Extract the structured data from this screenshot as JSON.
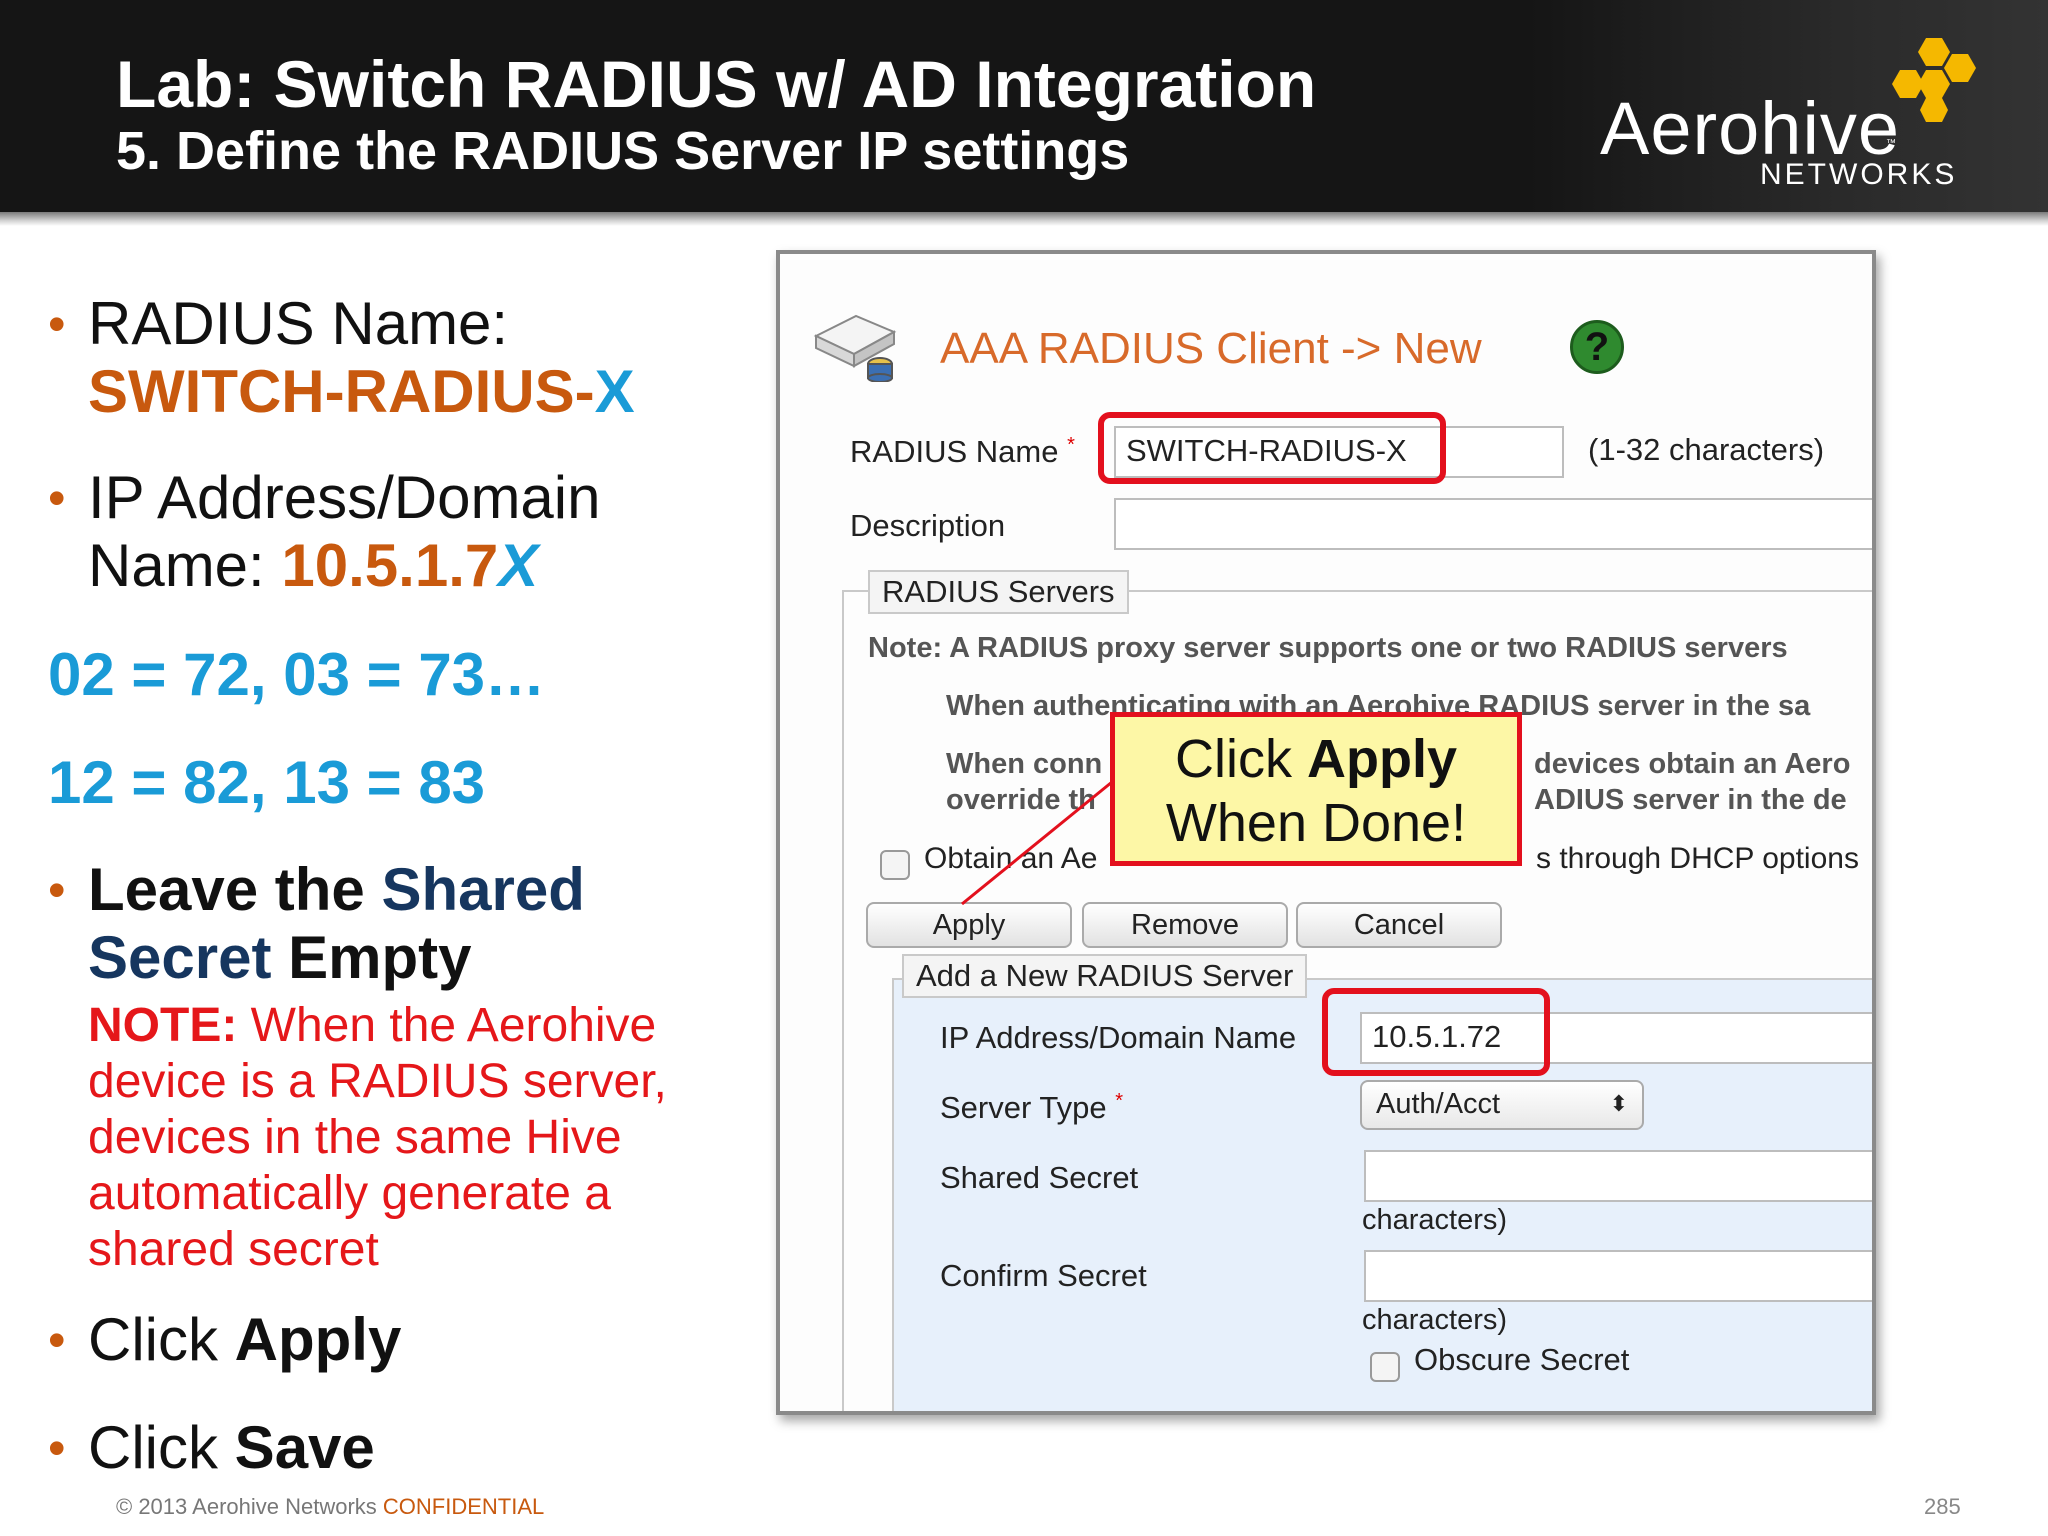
{
  "header": {
    "title": "Lab: Switch RADIUS w/ AD Integration",
    "subtitle": "5. Define the RADIUS Server IP settings",
    "logo_word": "Aerohive",
    "logo_tm": "™",
    "logo_networks": "NETWORKS"
  },
  "bullets": {
    "b1_label": "RADIUS Name:",
    "b1_value_main": "SWITCH-RADIUS-",
    "b1_value_var": "X",
    "b2_line1": "IP Address/Domain",
    "b2_line2_label": "Name: ",
    "b2_value_main": "10.5.1.7",
    "b2_value_var": "X",
    "map1": "02 = 72, 03 = 73…",
    "map2": "12 = 82, 13 = 83",
    "b3_leave": "Leave the ",
    "b3_shared": "Shared",
    "b3_secret": "Secret",
    "b3_empty": " Empty",
    "note_label": "NOTE:",
    "note_l1": " When the Aerohive",
    "note_l2": "device is a RADIUS server,",
    "note_l3": "devices in the same Hive",
    "note_l4": "automatically generate a",
    "note_l5": "shared secret",
    "b4_click": "Click ",
    "b4_apply": "Apply",
    "b5_click": "Click ",
    "b5_save": "Save",
    "bullet_char": "•"
  },
  "footer": {
    "copyright": "© 2013 Aerohive Networks ",
    "confidential": "CONFIDENTIAL",
    "page_number": "285"
  },
  "panel": {
    "title": "AAA RADIUS Client -> New",
    "help_glyph": "?",
    "radius_name_label": "RADIUS Name",
    "required_mark": "*",
    "radius_name_value": "SWITCH-RADIUS-X",
    "radius_name_hint": "(1-32 characters)",
    "description_label": "Description",
    "description_value": "",
    "servers_legend": "RADIUS Servers",
    "note_line": "Note: A RADIUS proxy server supports one or two RADIUS servers",
    "note_when_auth": "When authenticating with an Aerohive RADIUS server in the sa",
    "note_when_conn": "When conn",
    "note_devices_obtain": "devices obtain an Aero",
    "note_override": "override th",
    "note_radius_server_de": "ADIUS server in the de",
    "obtain_label_start": "Obtain an Ae",
    "obtain_label_end": "s through DHCP options",
    "apply_button": "Apply",
    "remove_button": "Remove",
    "cancel_button": "Cancel",
    "add_server_legend": "Add a New RADIUS Server",
    "ip_label": "IP Address/Domain Name",
    "ip_value": "10.5.1.72",
    "server_type_label": "Server Type",
    "server_type_value": "Auth/Acct",
    "server_type_arrows": "⬍",
    "shared_secret_label": "Shared Secret",
    "shared_secret_hint": "characters)",
    "confirm_secret_label": "Confirm Secret",
    "confirm_secret_hint": "characters)",
    "obscure_label": "Obscure Secret"
  },
  "callout": {
    "line1_a": "Click ",
    "line1_b": "Apply",
    "line2": "When Done!"
  },
  "colors": {
    "accent_orange": "#c8590e",
    "accent_blue": "#1a9bd7",
    "navy": "#16365f",
    "note_red": "#e5171a",
    "highlight_red": "#e3101d",
    "callout_yellow": "#fdf7a6",
    "logo_hex_yellow": "#f5b800"
  }
}
